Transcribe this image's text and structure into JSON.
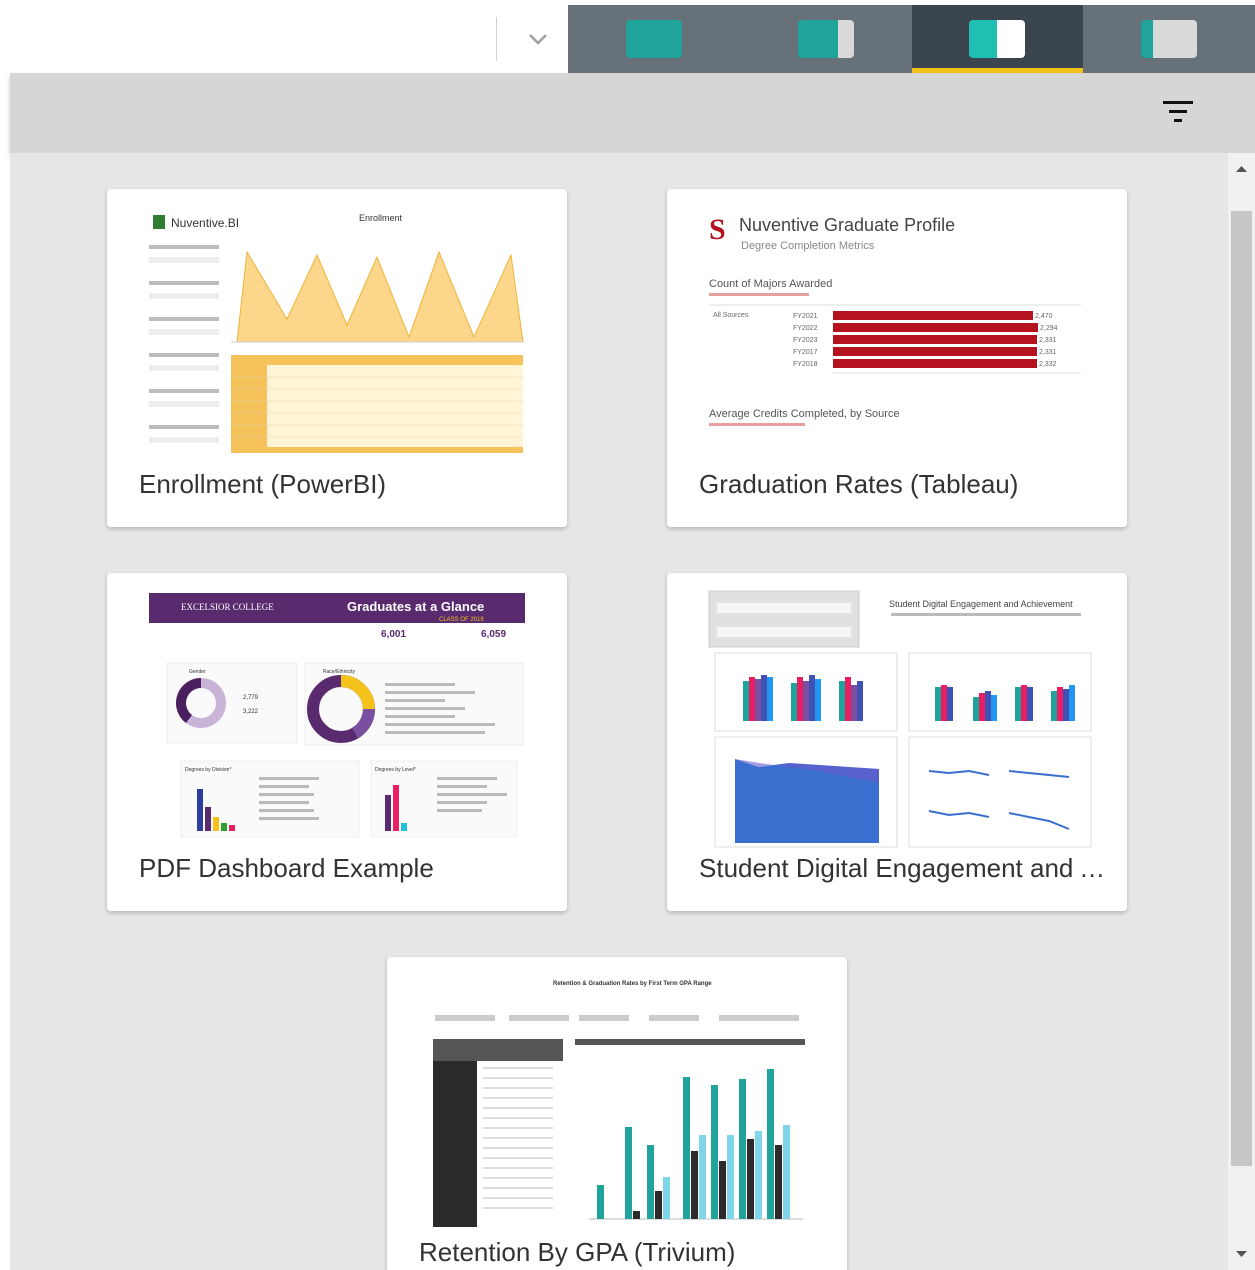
{
  "toolbar": {
    "view_tabs": [
      {
        "name": "view-tab-1",
        "active": false
      },
      {
        "name": "view-tab-2",
        "active": false
      },
      {
        "name": "view-tab-3",
        "active": true
      },
      {
        "name": "view-tab-4",
        "active": false
      }
    ],
    "icons": [
      "chevron-down-icon",
      "filter-icon"
    ]
  },
  "colors": {
    "accent": "#f4c21b",
    "tab_bar": "#66717a",
    "tab_active": "#3a4550",
    "teal": "#1fa39a",
    "content_bg": "#e6e6e6"
  },
  "cards": [
    {
      "title": "Enrollment (PowerBI)",
      "thumb": {
        "brand": "Nuventive.BI",
        "heading": "Enrollment"
      }
    },
    {
      "title": "Graduation Rates (Tableau)",
      "thumb": {
        "heading": "Nuventive Graduate Profile",
        "subheading": "Degree Completion Metrics",
        "section1": "Count of Majors Awarded",
        "section2": "Average Credits Completed, by Source",
        "row_group": "All Sources",
        "rows": [
          "FY2021",
          "FY2022",
          "FY2023",
          "FY2017",
          "FY2018"
        ],
        "values": [
          "2,470",
          "2,294",
          "2,331",
          "2,331",
          "2,332"
        ]
      }
    },
    {
      "title": "PDF Dashboard Example",
      "thumb": {
        "brand": "EXCELSIOR COLLEGE",
        "heading": "Graduates at a Glance",
        "sub": "CLASS OF 2019",
        "stat1": "6,001",
        "stat2": "6,059",
        "label1": "Gender",
        "label2": "Race/Ethnicity",
        "label3": "Degrees by Division*",
        "label4": "Degrees by Level*",
        "gender1": "2,779",
        "gender2": "3,222"
      }
    },
    {
      "title": "Student Digital Engagement and Achievement",
      "thumb": {
        "heading": "Student Digital Engagement and Achievement"
      }
    },
    {
      "title": "Retention By GPA (Trivium)",
      "thumb": {
        "heading": "Retention & Graduation Rates by First Term GPA Range"
      }
    }
  ]
}
